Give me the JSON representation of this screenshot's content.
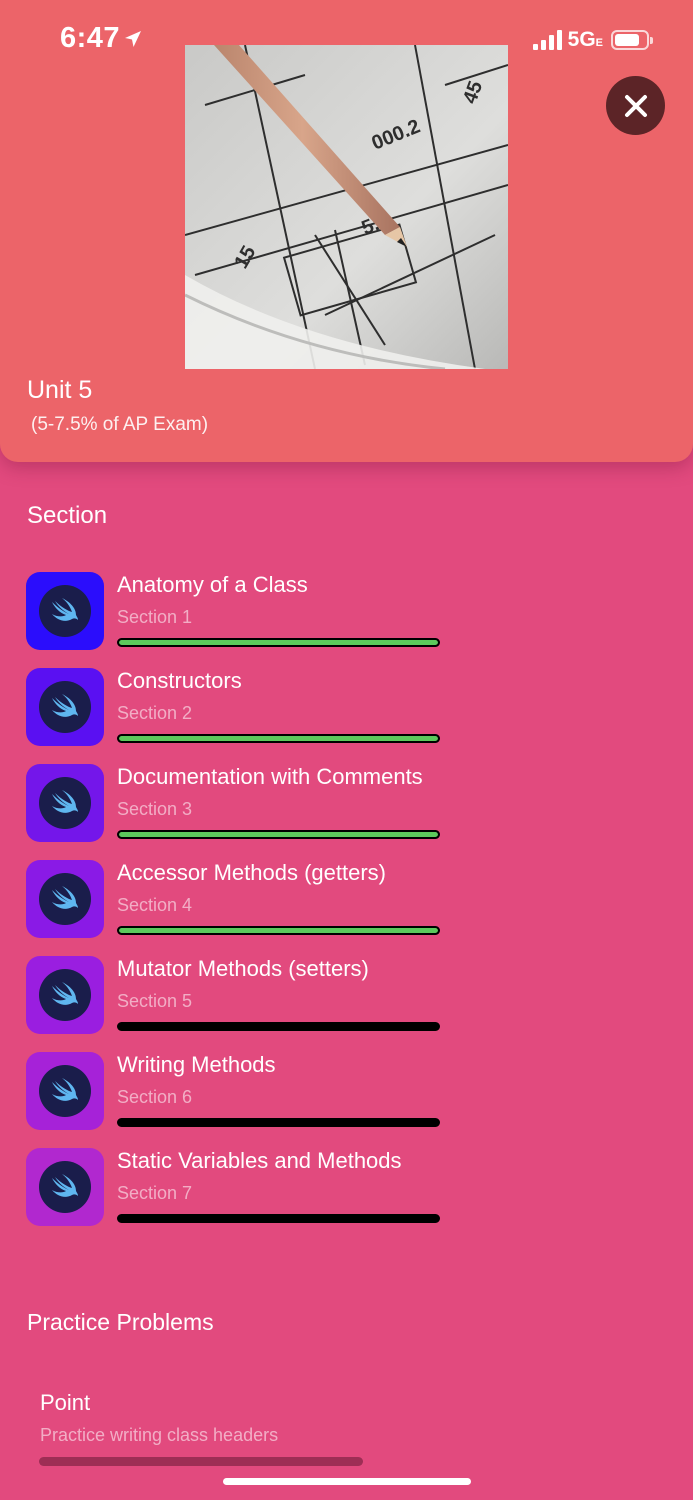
{
  "status_bar": {
    "time": "6:47",
    "network": "5G",
    "network_suffix": "E"
  },
  "header": {
    "title": "Unit 5",
    "subtitle": "(5-7.5% of AP Exam)",
    "close_icon": "xmark-icon",
    "hero_image": "pencil-blueprint-photo"
  },
  "sections_heading": "Section",
  "sections": [
    {
      "title": "Anatomy of a Class",
      "subtitle": "Section 1",
      "progress": 1,
      "icon_color": "#2b0dfc"
    },
    {
      "title": "Constructors",
      "subtitle": "Section 2",
      "progress": 1,
      "icon_color": "#5a10f2"
    },
    {
      "title": "Documentation with Comments",
      "subtitle": "Section 3",
      "progress": 1,
      "icon_color": "#7416ea"
    },
    {
      "title": "Accessor Methods (getters)",
      "subtitle": "Section 4",
      "progress": 1,
      "icon_color": "#8a1ae6"
    },
    {
      "title": "Mutator Methods (setters)",
      "subtitle": "Section 5",
      "progress": 0,
      "icon_color": "#9a1ee0"
    },
    {
      "title": "Writing Methods",
      "subtitle": "Section 6",
      "progress": 0,
      "icon_color": "#a622d8"
    },
    {
      "title": "Static Variables and Methods",
      "subtitle": "Section 7",
      "progress": 0,
      "icon_color": "#b128cf"
    }
  ],
  "practice_heading": "Practice Problems",
  "practice_problems": [
    {
      "title": "Point",
      "subtitle": "Practice writing class headers"
    }
  ],
  "colors": {
    "background": "#e24a7e",
    "header": "#ec6469",
    "progress_fill": "#5cc95c",
    "icon_inner": "#1a1d4b"
  }
}
